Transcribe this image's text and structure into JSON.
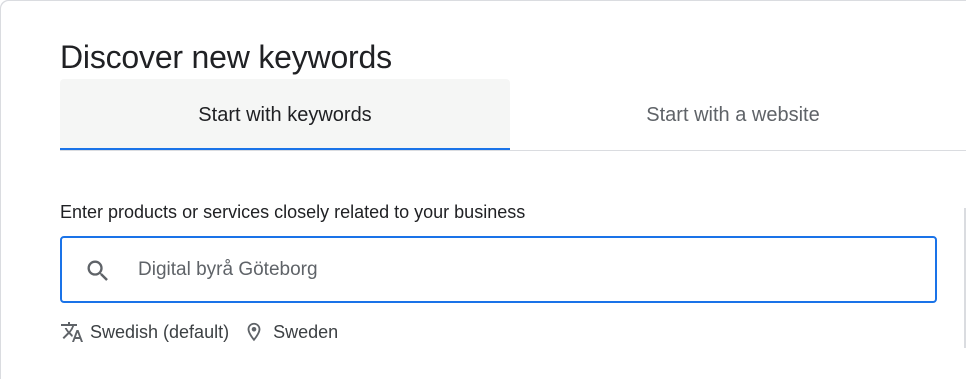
{
  "page": {
    "title": "Discover new keywords"
  },
  "tabs": [
    {
      "label": "Start with keywords",
      "active": true
    },
    {
      "label": "Start with a website",
      "active": false
    }
  ],
  "form": {
    "label": "Enter products or services closely related to your business",
    "search": {
      "value": "",
      "placeholder": "Digital byrå Göteborg",
      "icon": "search-icon"
    }
  },
  "targeting": {
    "language": {
      "label": "Swedish (default)",
      "icon": "translate-icon"
    },
    "location": {
      "label": "Sweden",
      "icon": "location-pin-icon"
    }
  },
  "colors": {
    "accent": "#1a73e8",
    "active_tab_bg": "#f5f6f5",
    "text_primary": "#202124",
    "text_secondary": "#5f6368"
  }
}
